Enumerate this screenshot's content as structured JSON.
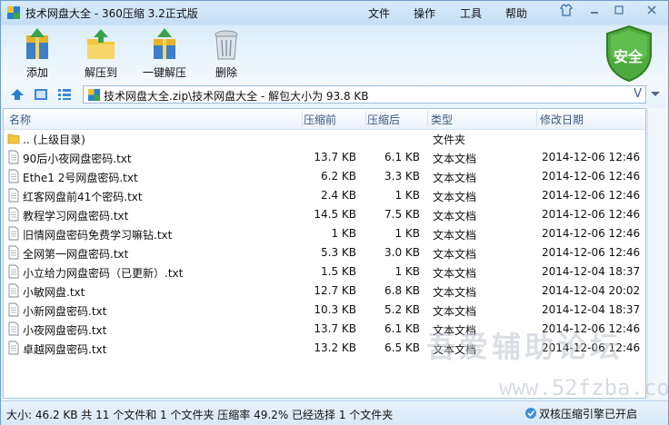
{
  "window": {
    "title": "技术网盘大全 - 360压缩 3.2正式版"
  },
  "menu": [
    "文件",
    "操作",
    "工具",
    "帮助"
  ],
  "toolbar": {
    "add": "添加",
    "extract_to": "解压到",
    "one_click_extract": "一键解压",
    "delete": "删除"
  },
  "security_badge": "安全",
  "address": {
    "path": "技术网盘大全.zip\\技术网盘大全 - 解包大小为 93.8 KB",
    "dropdown": "V"
  },
  "columns": {
    "name": "名称",
    "compressed": "压缩前",
    "packed": "压缩后",
    "type": "类型",
    "modified": "修改日期"
  },
  "files": [
    {
      "name": ".. (上级目录)",
      "compressed": "",
      "packed": "",
      "type": "文件夹",
      "modified": "",
      "icon": "folder-icon"
    },
    {
      "name": "90后小夜网盘密码.txt",
      "compressed": "13.7 KB",
      "packed": "6.1 KB",
      "type": "文本文档",
      "modified": "2014-12-06 12:46",
      "icon": "text-file-icon"
    },
    {
      "name": "Ethe1  2号网盘密码.txt",
      "compressed": "6.2 KB",
      "packed": "3.3 KB",
      "type": "文本文档",
      "modified": "2014-12-06 12:46",
      "icon": "text-file-icon"
    },
    {
      "name": "红客网盘前41个密码.txt",
      "compressed": "2.4 KB",
      "packed": "1 KB",
      "type": "文本文档",
      "modified": "2014-12-06 12:46",
      "icon": "text-file-icon"
    },
    {
      "name": "教程学习网盘密码.txt",
      "compressed": "14.5 KB",
      "packed": "7.5 KB",
      "type": "文本文档",
      "modified": "2014-12-06 12:46",
      "icon": "text-file-icon"
    },
    {
      "name": "旧情网盘密码免费学习嘛钻.txt",
      "compressed": "1 KB",
      "packed": "1 KB",
      "type": "文本文档",
      "modified": "2014-12-06 12:46",
      "icon": "text-file-icon"
    },
    {
      "name": "全网第一网盘密码.txt",
      "compressed": "5.3 KB",
      "packed": "3.0 KB",
      "type": "文本文档",
      "modified": "2014-12-06 12:46",
      "icon": "text-file-icon"
    },
    {
      "name": "小立给力网盘密码（已更新）.txt",
      "compressed": "1.5 KB",
      "packed": "1 KB",
      "type": "文本文档",
      "modified": "2014-12-04 18:37",
      "icon": "text-file-icon"
    },
    {
      "name": "小敏网盘.txt",
      "compressed": "12.7 KB",
      "packed": "6.8 KB",
      "type": "文本文档",
      "modified": "2014-12-04 20:02",
      "icon": "text-file-icon"
    },
    {
      "name": "小新网盘密码.txt",
      "compressed": "10.3 KB",
      "packed": "5.2 KB",
      "type": "文本文档",
      "modified": "2014-12-04 18:37",
      "icon": "text-file-icon"
    },
    {
      "name": "小夜网盘密码.txt",
      "compressed": "13.7 KB",
      "packed": "6.1 KB",
      "type": "文本文档",
      "modified": "2014-12-06 12:46",
      "icon": "text-file-icon"
    },
    {
      "name": "卓越网盘密码.txt",
      "compressed": "13.2 KB",
      "packed": "6.5 KB",
      "type": "文本文档",
      "modified": "2014-12-06 12:46",
      "icon": "text-file-icon"
    }
  ],
  "status": {
    "summary": "大小: 46.2 KB 共 11 个文件和 1 个文件夹 压缩率 49.2% 已经选择 1 个文件夹",
    "engine": "双核压缩引擎已开启"
  },
  "watermark": {
    "cn": "吾爱辅助论坛",
    "url": "www.52fzba.com"
  }
}
